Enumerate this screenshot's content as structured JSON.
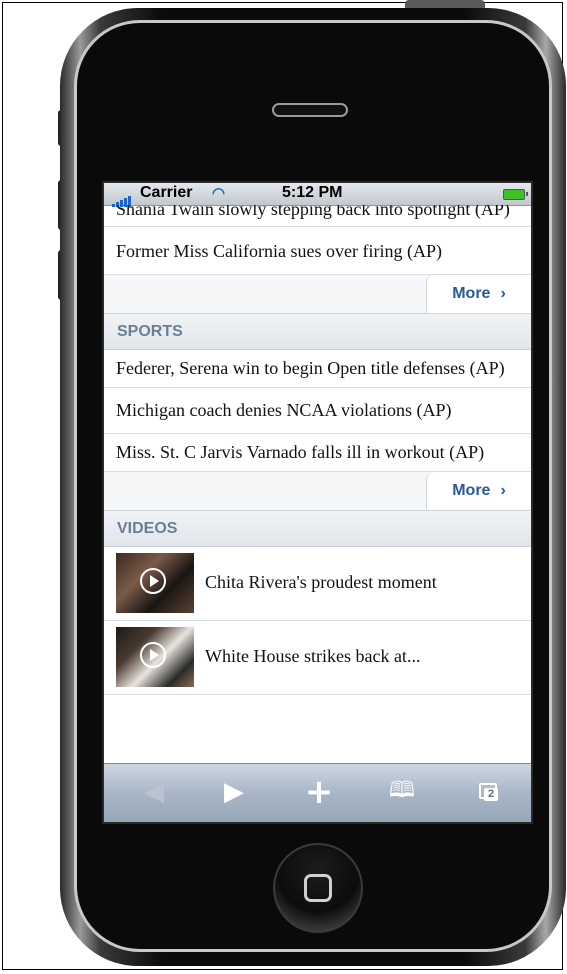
{
  "status_bar": {
    "carrier": "Carrier",
    "time": "5:12 PM",
    "icons": [
      "signal-icon",
      "wifi-icon",
      "battery-icon"
    ]
  },
  "entertainment": {
    "items": [
      "Shania Twain slowly stepping back into spotlight (AP)",
      "Former Miss California sues over firing (AP)"
    ],
    "more_label": "More",
    "more_chevron": "›"
  },
  "sports": {
    "header": "SPORTS",
    "items": [
      "Federer, Serena win to begin Open title defenses (AP)",
      "Michigan coach denies NCAA violations (AP)",
      "Miss. St. C Jarvis Varnado falls ill in workout (AP)"
    ],
    "more_label": "More",
    "more_chevron": "›"
  },
  "videos": {
    "header": "VIDEOS",
    "items": [
      "Chita Rivera's proudest moment",
      "White House strikes back at..."
    ]
  },
  "toolbar": {
    "back_glyph": "◀",
    "forward_glyph": "▶",
    "add_glyph": "+",
    "bookmarks_glyph": "🕮",
    "pages_count": "2"
  }
}
